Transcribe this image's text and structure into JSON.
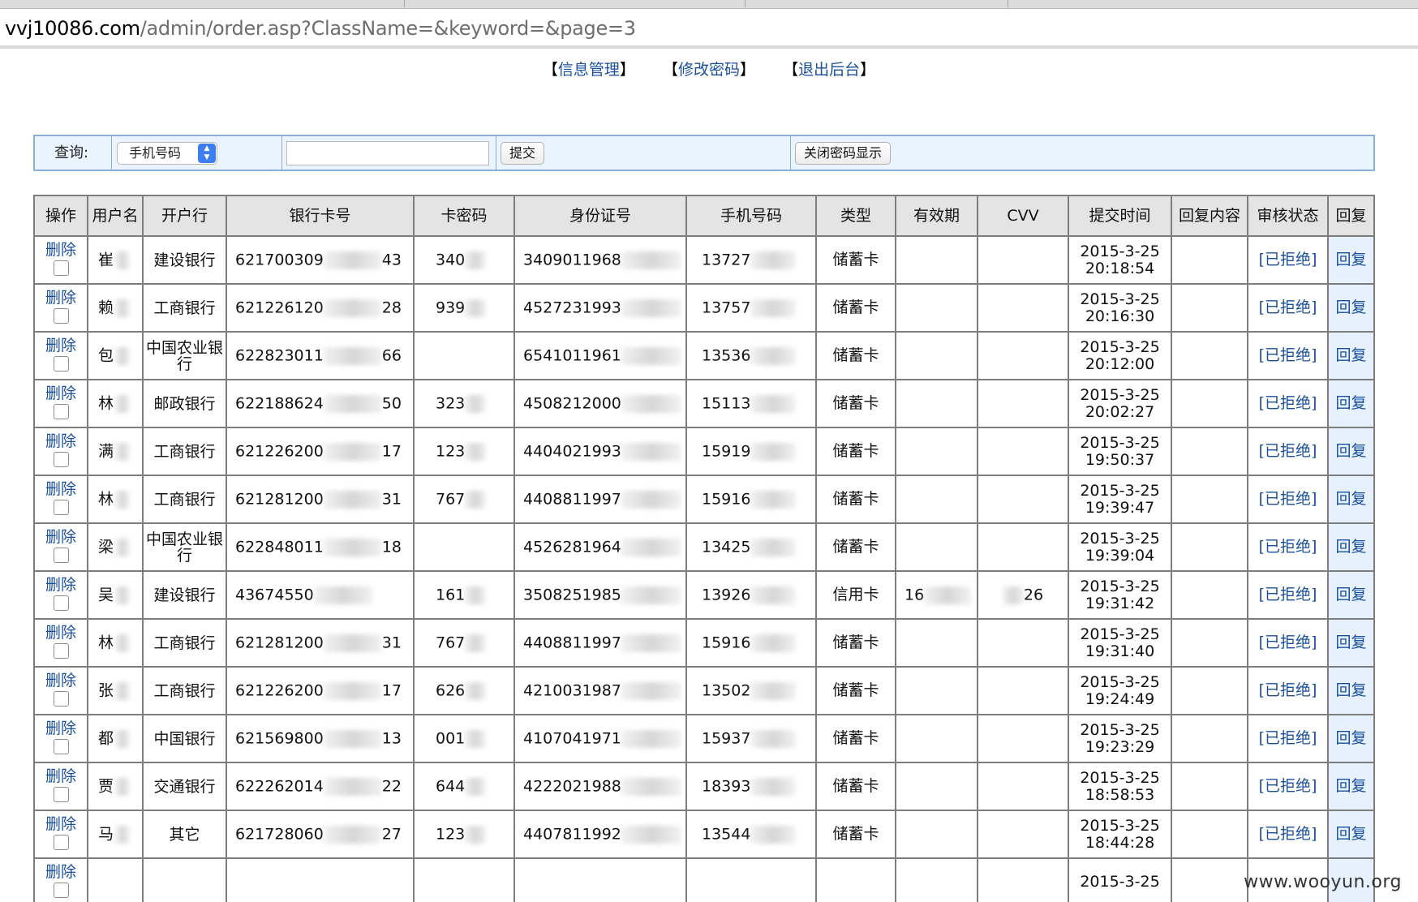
{
  "browser": {
    "url_host": "vvj10086.com",
    "url_path": "/admin/order.asp?ClassName=&keyword=&page=3"
  },
  "nav": {
    "items": [
      "信息管理",
      "修改密码",
      "退出后台"
    ],
    "bracket_open": "【",
    "bracket_close": "】"
  },
  "search": {
    "label": "查询:",
    "select_value": "手机号码",
    "input_value": "",
    "submit_label": "提交",
    "toggle_label": "关闭密码显示"
  },
  "table": {
    "headers": [
      "操作",
      "用户名",
      "开户行",
      "银行卡号",
      "卡密码",
      "身份证号",
      "手机号码",
      "类型",
      "有效期",
      "CVV",
      "提交时间",
      "回复内容",
      "审核状态",
      "回复"
    ],
    "delete_label": "删除",
    "status_label": "[已拒绝]",
    "reply_label": "回复",
    "rows": [
      {
        "name": "崔",
        "bank": "建设银行",
        "card": "621700309",
        "card_end": "43",
        "pin": "340",
        "id": "3409011968",
        "phone": "13727",
        "type": "储蓄卡",
        "expiry": "",
        "cvv": "",
        "time_date": "2015-3-25",
        "time_clock": "20:18:54"
      },
      {
        "name": "赖",
        "bank": "工商银行",
        "card": "621226120",
        "card_end": "28",
        "pin": "939",
        "id": "4527231993",
        "phone": "13757",
        "type": "储蓄卡",
        "expiry": "",
        "cvv": "",
        "time_date": "2015-3-25",
        "time_clock": "20:16:30"
      },
      {
        "name": "包",
        "bank": "中国农业银行",
        "card": "622823011",
        "card_end": "66",
        "pin": "",
        "id": "6541011961",
        "phone": "13536",
        "type": "储蓄卡",
        "expiry": "",
        "cvv": "",
        "time_date": "2015-3-25",
        "time_clock": "20:12:00"
      },
      {
        "name": "林",
        "bank": "邮政银行",
        "card": "622188624",
        "card_end": "50",
        "pin": "323",
        "id": "4508212000",
        "phone": "15113",
        "type": "储蓄卡",
        "expiry": "",
        "cvv": "",
        "time_date": "2015-3-25",
        "time_clock": "20:02:27"
      },
      {
        "name": "满",
        "bank": "工商银行",
        "card": "621226200",
        "card_end": "17",
        "pin": "123",
        "id": "4404021993",
        "phone": "15919",
        "type": "储蓄卡",
        "expiry": "",
        "cvv": "",
        "time_date": "2015-3-25",
        "time_clock": "19:50:37"
      },
      {
        "name": "林",
        "bank": "工商银行",
        "card": "621281200",
        "card_end": "31",
        "pin": "767",
        "id": "4408811997",
        "phone": "15916",
        "type": "储蓄卡",
        "expiry": "",
        "cvv": "",
        "time_date": "2015-3-25",
        "time_clock": "19:39:47"
      },
      {
        "name": "梁",
        "bank": "中国农业银行",
        "card": "622848011",
        "card_end": "18",
        "pin": "",
        "id": "4526281964",
        "phone": "13425",
        "type": "储蓄卡",
        "expiry": "",
        "cvv": "",
        "time_date": "2015-3-25",
        "time_clock": "19:39:04"
      },
      {
        "name": "吴",
        "bank": "建设银行",
        "card": "43674550",
        "card_end": "",
        "pin": "161",
        "id": "3508251985",
        "phone": "13926",
        "type": "信用卡",
        "expiry": "16",
        "cvv": "26",
        "time_date": "2015-3-25",
        "time_clock": "19:31:42"
      },
      {
        "name": "林",
        "bank": "工商银行",
        "card": "621281200",
        "card_end": "31",
        "pin": "767",
        "id": "4408811997",
        "phone": "15916",
        "type": "储蓄卡",
        "expiry": "",
        "cvv": "",
        "time_date": "2015-3-25",
        "time_clock": "19:31:40"
      },
      {
        "name": "张",
        "bank": "工商银行",
        "card": "621226200",
        "card_end": "17",
        "pin": "626",
        "id": "4210031987",
        "phone": "13502",
        "type": "储蓄卡",
        "expiry": "",
        "cvv": "",
        "time_date": "2015-3-25",
        "time_clock": "19:24:49"
      },
      {
        "name": "都",
        "bank": "中国银行",
        "card": "621569800",
        "card_end": "13",
        "pin": "001",
        "id": "4107041971",
        "phone": "15937",
        "type": "储蓄卡",
        "expiry": "",
        "cvv": "",
        "time_date": "2015-3-25",
        "time_clock": "19:23:29"
      },
      {
        "name": "贾",
        "bank": "交通银行",
        "card": "622262014",
        "card_end": "22",
        "pin": "644",
        "id": "4222021988",
        "phone": "18393",
        "type": "储蓄卡",
        "expiry": "",
        "cvv": "",
        "time_date": "2015-3-25",
        "time_clock": "18:58:53"
      },
      {
        "name": "马",
        "bank": "其它",
        "card": "621728060",
        "card_end": "27",
        "pin": "123",
        "id": "4407811992",
        "phone": "13544",
        "type": "储蓄卡",
        "expiry": "",
        "cvv": "",
        "time_date": "2015-3-25",
        "time_clock": "18:44:28"
      },
      {
        "name": "",
        "bank": "",
        "card": "",
        "card_end": "",
        "pin": "",
        "id": "",
        "phone": "",
        "type": "",
        "expiry": "",
        "cvv": "",
        "time_date": "2015-3-25",
        "time_clock": ""
      }
    ]
  },
  "watermark": "www.wooyun.org"
}
